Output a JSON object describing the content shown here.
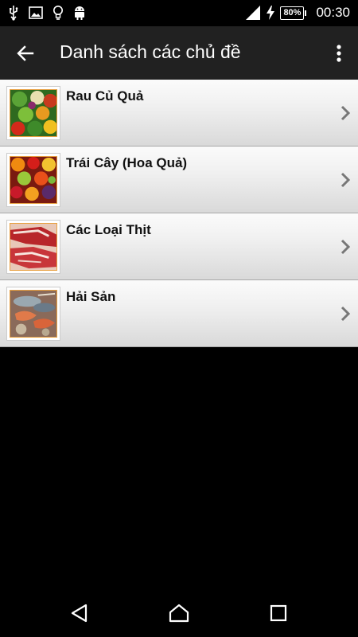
{
  "status_bar": {
    "icons_left": [
      "usb-icon",
      "image-icon",
      "lightbulb-icon",
      "android-icon"
    ],
    "battery": "80%",
    "time": "00:30"
  },
  "action_bar": {
    "title": "Danh sách các chủ đề",
    "back_icon": "arrow-left-icon",
    "menu_icon": "more-vert-icon"
  },
  "topics": [
    {
      "label": "Rau Củ Quả",
      "thumb": "vegetables-photo"
    },
    {
      "label": "Trái Cây (Hoa Quả)",
      "thumb": "fruits-photo"
    },
    {
      "label": "Các Loại Thịt",
      "thumb": "meat-photo"
    },
    {
      "label": "Hải Sản",
      "thumb": "seafood-photo"
    }
  ],
  "nav_bar": {
    "back": "triangle-back-icon",
    "home": "home-icon",
    "recents": "square-recents-icon"
  }
}
